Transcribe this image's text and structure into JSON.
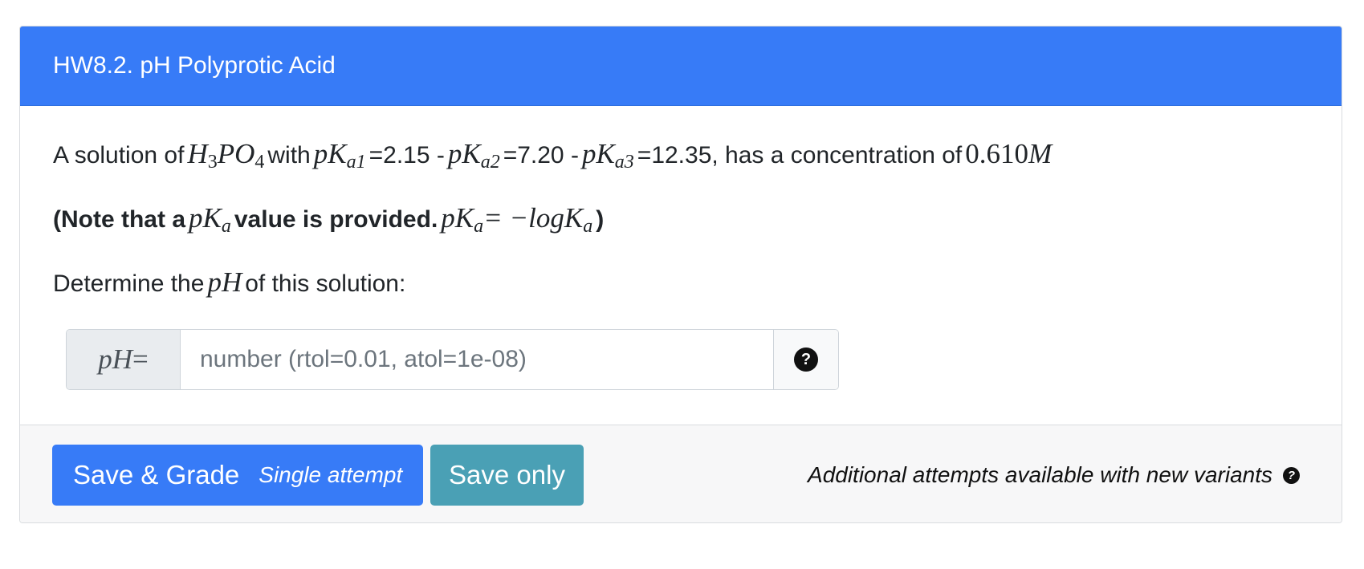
{
  "header": {
    "title": "HW8.2. pH Polyprotic Acid"
  },
  "question": {
    "line1": {
      "text_a": "A solution of",
      "formula_main_1": "H",
      "formula_sub_1": "3",
      "formula_main_2": "PO",
      "formula_sub_2": "4",
      "text_b": "with",
      "pk_main": "pK",
      "pka1_sub": "a1",
      "pka1_value": "=2.15 -",
      "pka2_sub": "a2",
      "pka2_value": "=7.20 -",
      "pka3_sub": "a3",
      "pka3_value": "=12.35, has a concentration of",
      "conc_number": "0.610",
      "conc_unit": "M"
    },
    "line2": {
      "text_a": "(Note that a",
      "pk_main": "pK",
      "pk_sub": "a",
      "text_b": "value is provided.",
      "eq_lhs_main": "pK",
      "eq_lhs_sub": "a",
      "eq_op": "= −logK",
      "eq_rhs_sub": "a",
      "text_c": ")"
    },
    "line3": {
      "text_a": "Determine the",
      "ph": "pH",
      "text_b": "of this solution:"
    }
  },
  "answer_input": {
    "prefix_var": "pH",
    "prefix_eq": " =",
    "placeholder": "number (rtol=0.01, atol=1e-08)",
    "help_icon": "?"
  },
  "footer": {
    "grade_button_label": "Save & Grade",
    "grade_button_sub": "Single attempt",
    "save_button_label": "Save only",
    "note": "Additional attempts available with new variants",
    "note_icon": "?"
  }
}
